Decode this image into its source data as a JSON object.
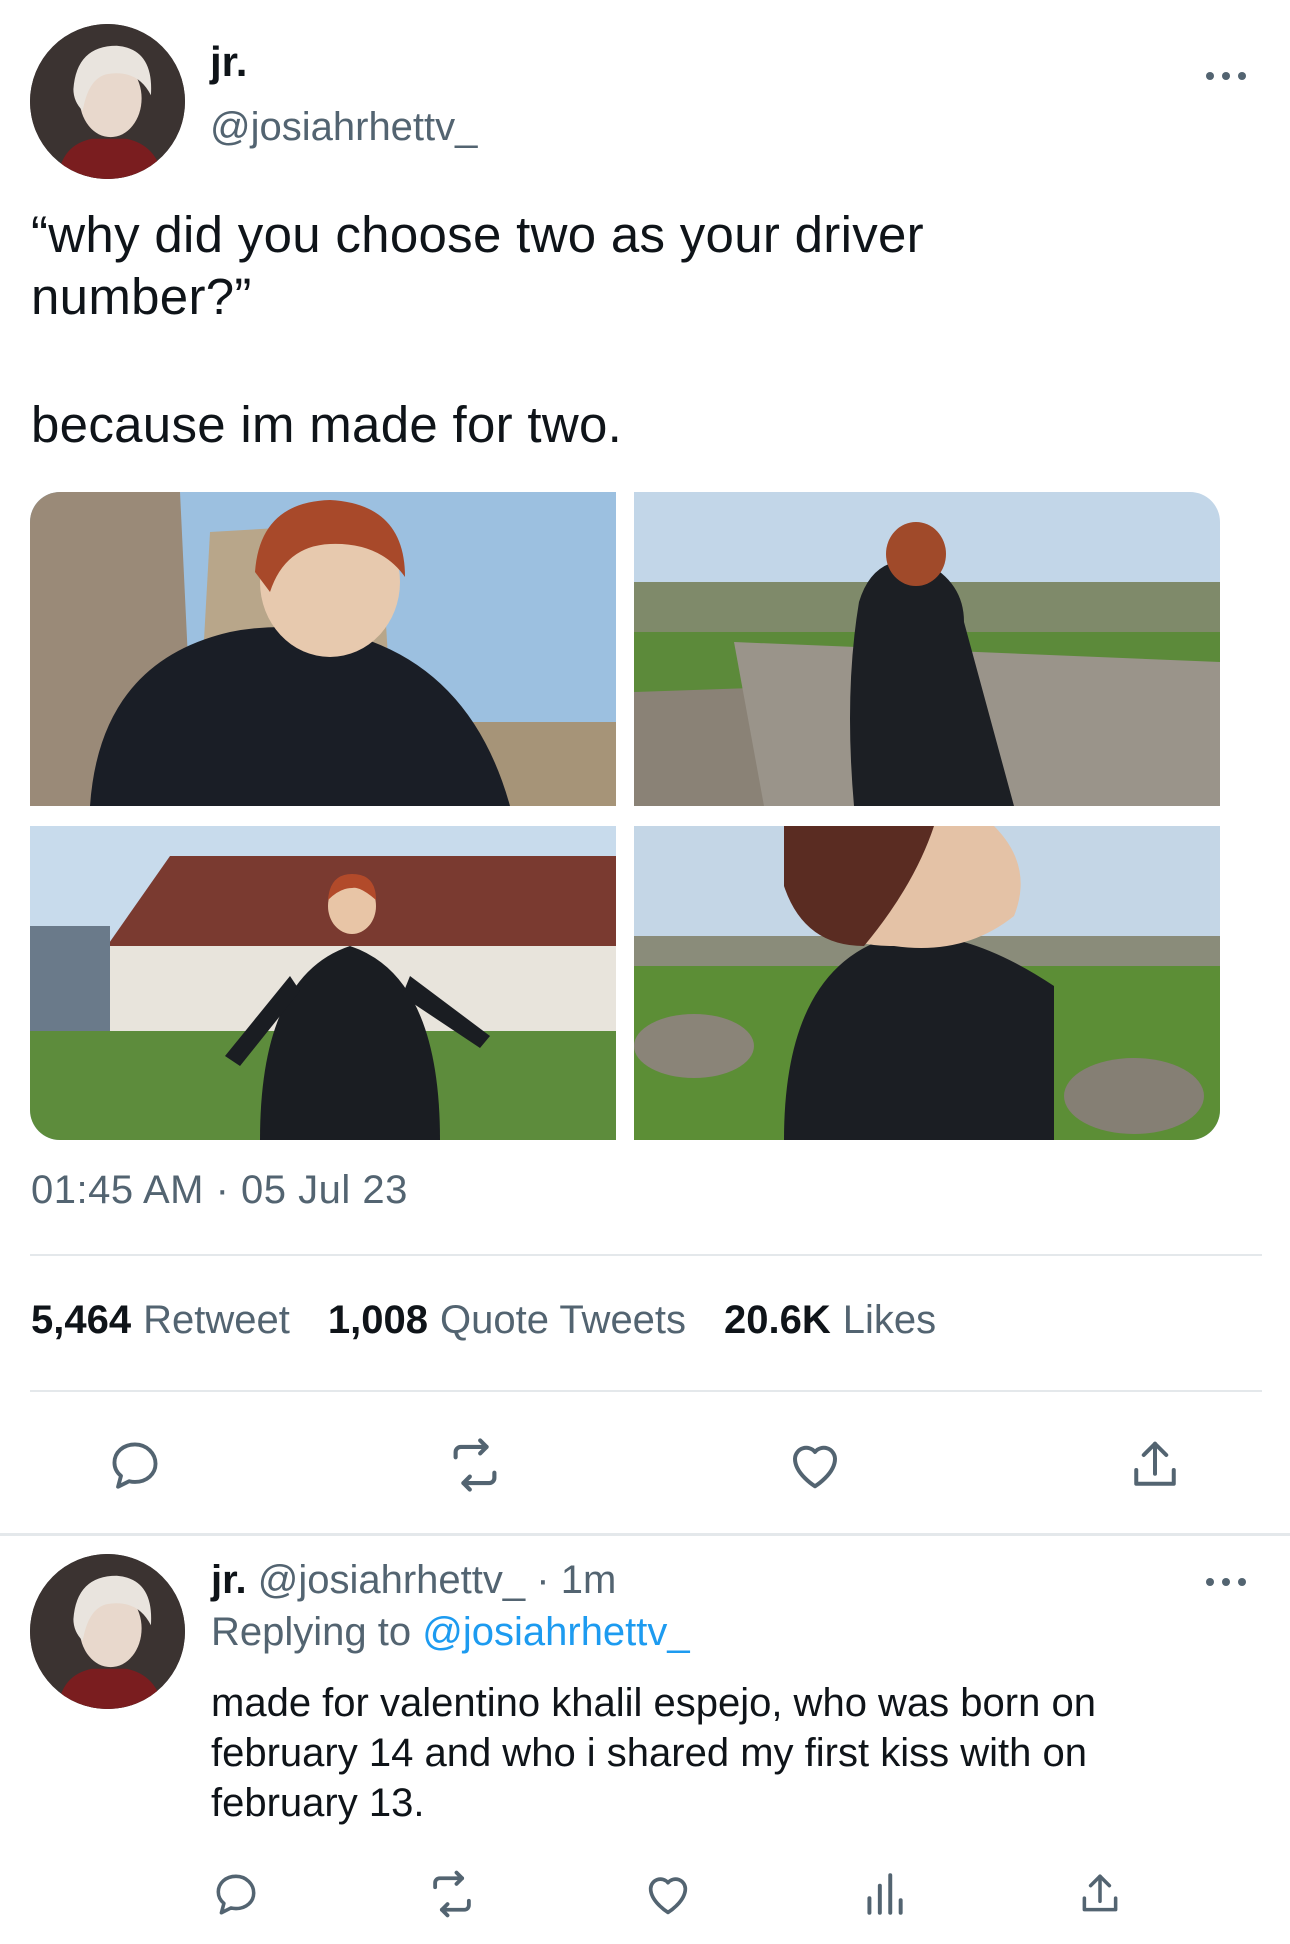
{
  "tweet": {
    "author_name": "jr.",
    "author_handle": "@josiahrhettv_",
    "text_line1": "“why did you choose two as your driver",
    "text_line2": "number?”",
    "text_line3": "because im made for two.",
    "timestamp": "01:45 AM · 05 Jul 23",
    "stats": {
      "retweets": "5,464",
      "retweets_label": "Retweet",
      "quotes": "1,008",
      "quotes_label": "Quote Tweets",
      "likes": "20.6K",
      "likes_label": "Likes"
    },
    "actions": [
      "reply-icon",
      "retweet-icon",
      "heart-icon",
      "share-icon"
    ]
  },
  "reply": {
    "author_name": "jr.",
    "author_handle": "@josiahrhettv_",
    "separator": "·",
    "time": "1m",
    "replying_prefix": "Replying to",
    "replying_to": "@josiahrhettv_",
    "text_line1": "made for valentino khalil espejo, who was born on",
    "text_line2": "february 14 and who i shared my first kiss with on",
    "text_line3": "february 13.",
    "actions": [
      "reply-icon",
      "retweet-icon",
      "heart-icon",
      "analytics-icon",
      "share-icon"
    ]
  },
  "colors": {
    "text": "#0f1419",
    "secondary": "#536471",
    "link": "#1d9bf0",
    "divider": "#e4e8eb"
  }
}
